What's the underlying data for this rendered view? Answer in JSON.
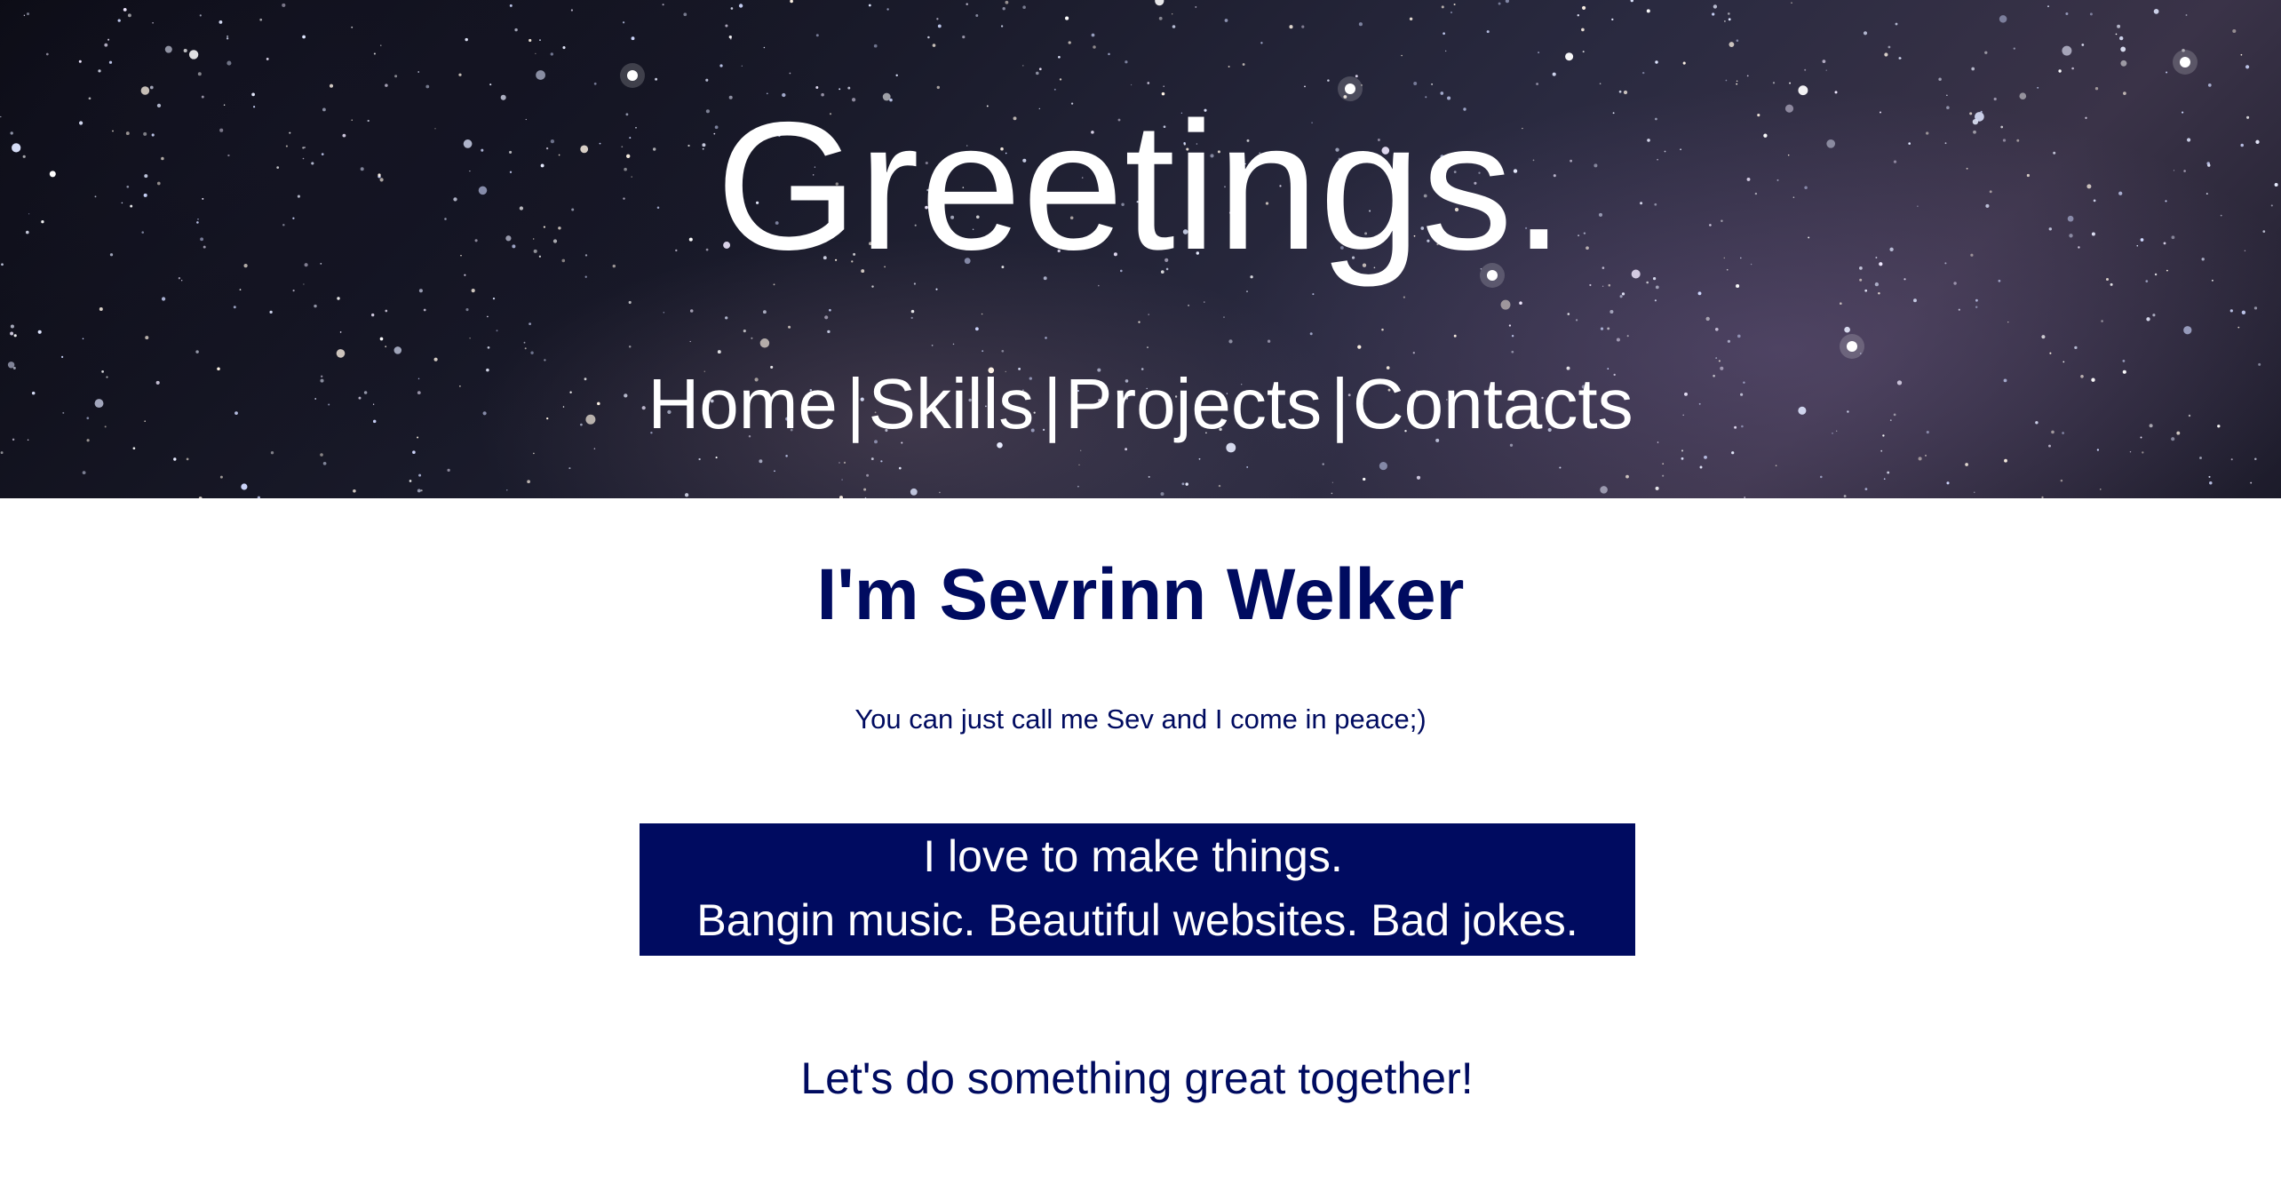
{
  "header": {
    "title": "Greetings."
  },
  "nav": {
    "items": [
      {
        "label": "Home"
      },
      {
        "label": "Skills"
      },
      {
        "label": "Projects"
      },
      {
        "label": "Contacts"
      }
    ],
    "separator": "|"
  },
  "intro": {
    "name": "I'm Sevrinn Welker",
    "subtitle": "You can just call me Sev and I come in peace;)"
  },
  "banner": {
    "line1": "I love to make things.",
    "line2": "Bangin music. Beautiful websites. Bad jokes."
  },
  "cta": {
    "text": "Let's do something great together!"
  },
  "colors": {
    "navy": "#000b60",
    "white": "#ffffff"
  }
}
